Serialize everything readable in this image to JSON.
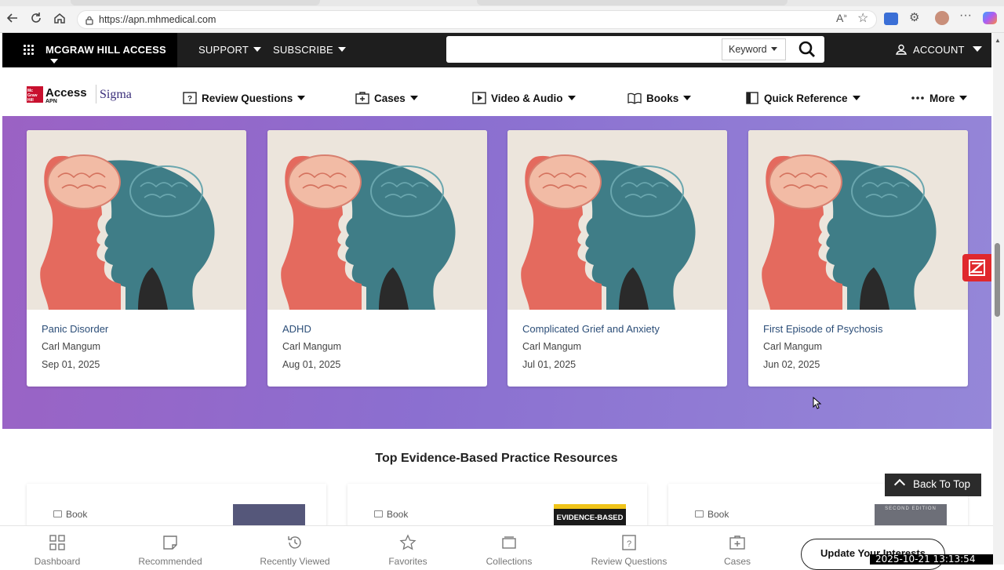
{
  "browser": {
    "url": "https://apn.mhmedical.com"
  },
  "topbar": {
    "brand_label": "MCGRAW HILL ACCESS",
    "support_label": "SUPPORT",
    "subscribe_label": "SUBSCRIBE",
    "search_value": "",
    "search_scope": "Keyword",
    "account_label": "ACCOUNT"
  },
  "logo": {
    "access_text": "Access",
    "apn_text": "APN",
    "sigma_text": "Sigma",
    "mh_text": "Mc Graw Hill"
  },
  "subnav": {
    "items": [
      {
        "label": "Review Questions",
        "icon": "review-questions-icon"
      },
      {
        "label": "Cases",
        "icon": "cases-icon"
      },
      {
        "label": "Video & Audio",
        "icon": "video-icon"
      },
      {
        "label": "Books",
        "icon": "books-icon"
      },
      {
        "label": "Quick Reference",
        "icon": "quick-reference-icon"
      },
      {
        "label": "More",
        "icon": "more-dots-icon"
      }
    ]
  },
  "cases": [
    {
      "title": "Panic Disorder",
      "author": "Carl Mangum",
      "date": "Sep 01, 2025"
    },
    {
      "title": "ADHD",
      "author": "Carl Mangum",
      "date": "Aug 01, 2025"
    },
    {
      "title": "Complicated Grief and Anxiety",
      "author": "Carl Mangum",
      "date": "Jul 01, 2025"
    },
    {
      "title": "First Episode of Psychosis",
      "author": "Carl Mangum",
      "date": "Jun 02, 2025"
    }
  ],
  "resources": {
    "heading": "Top Evidence-Based Practice Resources",
    "cards": [
      {
        "type_label": "Book"
      },
      {
        "type_label": "Book",
        "cover_text": "EVIDENCE-BASED"
      },
      {
        "type_label": "Book",
        "cover_text": "SECOND EDITION"
      }
    ]
  },
  "back_to_top_label": "Back To Top",
  "bottom_nav": {
    "items": [
      {
        "label": "Dashboard",
        "icon": "dashboard-icon"
      },
      {
        "label": "Recommended",
        "icon": "recommended-icon"
      },
      {
        "label": "Recently Viewed",
        "icon": "history-icon"
      },
      {
        "label": "Favorites",
        "icon": "star-icon"
      },
      {
        "label": "Collections",
        "icon": "collections-icon"
      },
      {
        "label": "Review Questions",
        "icon": "review-questions-icon"
      },
      {
        "label": "Cases",
        "icon": "cases-icon"
      }
    ],
    "update_label": "Update Your Interests"
  },
  "timestamp": "2025-10-21  13:13:54",
  "colors": {
    "band_start": "#9b62c4",
    "band_end": "#9587d8",
    "card_title": "#2c4e78",
    "z_badge": "#e0282d"
  }
}
